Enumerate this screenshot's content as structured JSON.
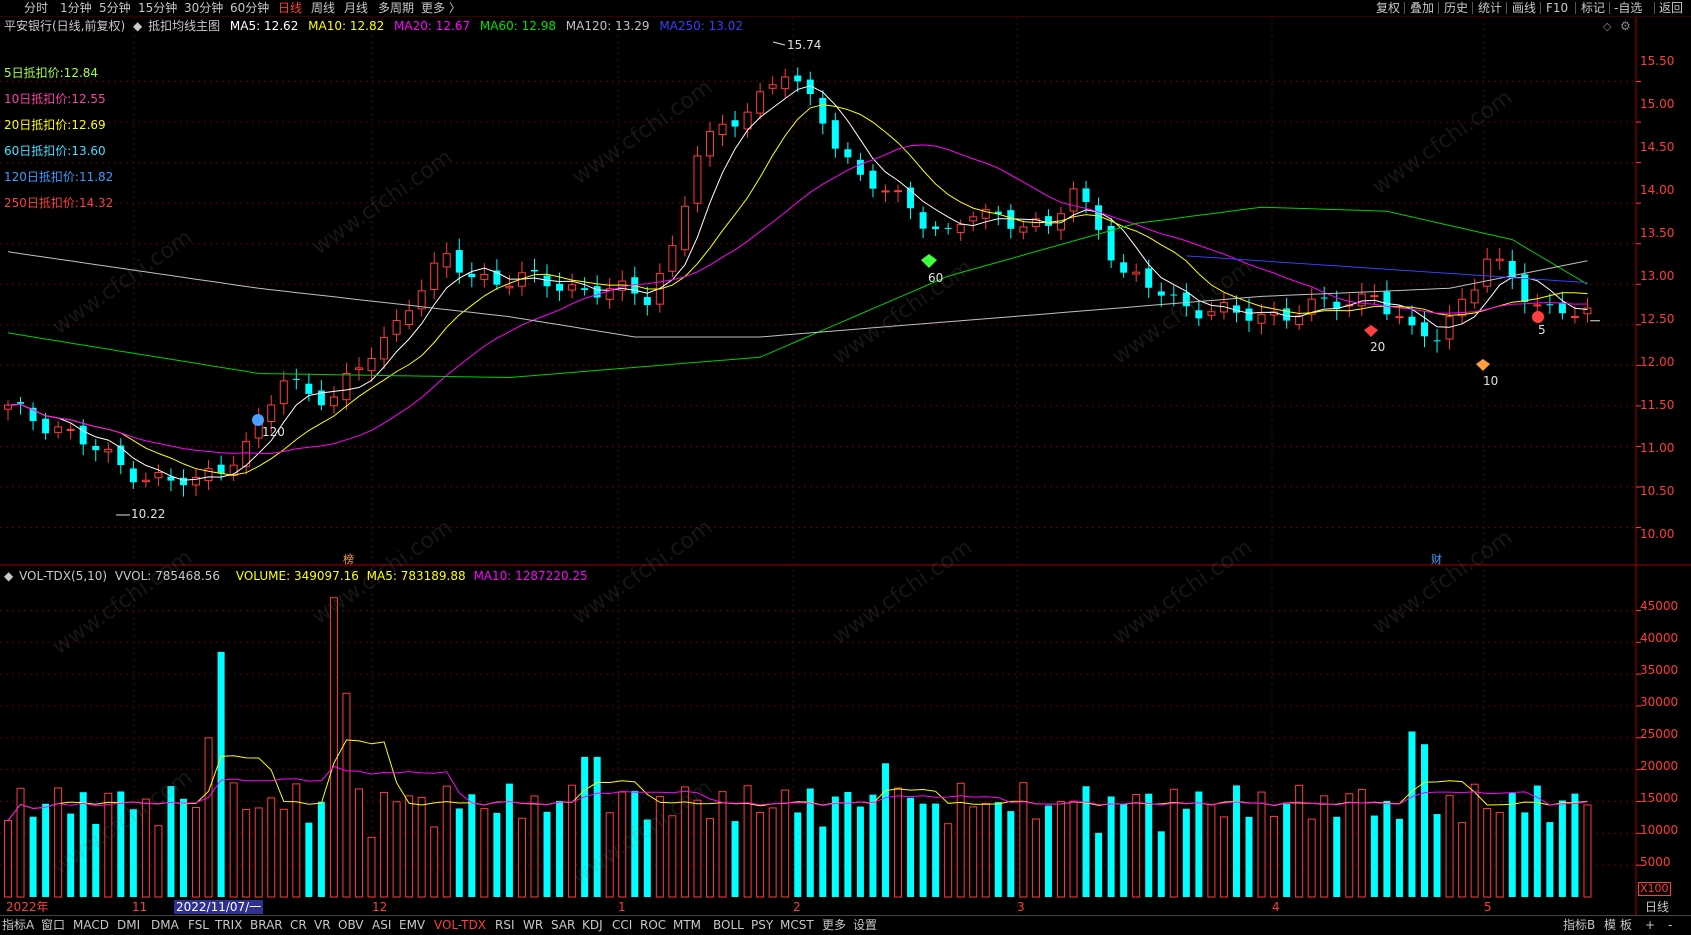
{
  "colors": {
    "up": "#ff3c3c",
    "down": "#00ffff",
    "ma5": "#ffffff",
    "ma10": "#ffff00",
    "ma20": "#ff00ff",
    "ma60": "#00d000",
    "ma120": "#c0c0c0",
    "ma250": "#3c3cff",
    "grid": "#5a0000",
    "axis_text": "#ff3c3c"
  },
  "top_periods": [
    "分时",
    "1分钟",
    "5分钟",
    "15分钟",
    "30分钟",
    "60分钟",
    "日线",
    "周线",
    "月线",
    "多周期",
    "更多 〉"
  ],
  "active_period": "日线",
  "top_right": [
    "复权",
    "叠加",
    "历史",
    "统计",
    "画线",
    "F10",
    "标记",
    "-自选",
    "返回"
  ],
  "main_info": {
    "stock": "平安银行(日线,前复权)",
    "indicator": "抵扣均线主图",
    "ma5": "MA5: 12.62",
    "ma10": "MA10: 12.82",
    "ma20": "MA20: 12.67",
    "ma60": "MA60: 12.98",
    "ma120": "MA120: 13.29",
    "ma250": "MA250: 13.02"
  },
  "deduct_prices": [
    {
      "label": "5日抵扣价:12.84",
      "color": "#a0ff40"
    },
    {
      "label": "10日抵扣价:12.55",
      "color": "#ff3caa"
    },
    {
      "label": "20日抵扣价:12.69",
      "color": "#ffff00"
    },
    {
      "label": "60日抵扣价:13.60",
      "color": "#40e0ff"
    },
    {
      "label": "120日抵扣价:11.82",
      "color": "#3c9cff"
    },
    {
      "label": "250日抵扣价:14.32",
      "color": "#ff3c3c"
    }
  ],
  "vol_info": {
    "name": "VOL-TDX(5,10)",
    "vvol": "VVOL: 785468.56",
    "volume": "VOLUME: 349097.16",
    "ma5": "MA5: 783189.88",
    "ma10": "MA10: 1287220.25"
  },
  "chart_data": {
    "type": "candlestick",
    "price_axis": {
      "ticks": [
        "15.50",
        "15.00",
        "14.50",
        "14.00",
        "13.50",
        "13.00",
        "12.50",
        "12.00",
        "11.50",
        "11.00",
        "10.50",
        "10.00"
      ],
      "range": [
        9.6,
        15.95
      ]
    },
    "volume_axis": {
      "ticks": [
        "45000",
        "40000",
        "35000",
        "30000",
        "25000",
        "20000",
        "15000",
        "10000",
        "5000"
      ],
      "range": [
        0,
        49000
      ],
      "unit": "X100"
    },
    "x_labels": [
      "2022年",
      "11",
      "12",
      "1",
      "2",
      "3",
      "4",
      "5"
    ],
    "cursor_date": "2022/11/07/一",
    "high_label": "15.74",
    "low_label": "10.22",
    "markers": [
      {
        "label": "120",
        "color": "#4aa0ff"
      },
      {
        "label": "60",
        "color": "#40ff40"
      },
      {
        "label": "20",
        "color": "#ff4040"
      },
      {
        "label": "10",
        "color": "#ffa040"
      },
      {
        "label": "5",
        "color": "#ff4040"
      }
    ],
    "event_tags": [
      "榜",
      "财"
    ],
    "period_tag": "日线"
  },
  "bottom_tabs": [
    "指标A",
    "窗口",
    "MACD",
    "DMI",
    "DMA",
    "FSL",
    "TRIX",
    "BRAR",
    "CR",
    "VR",
    "OBV",
    "ASI",
    "EMV",
    "VOL-TDX",
    "RSI",
    "WR",
    "SAR",
    "KDJ",
    "CCI",
    "ROC",
    "MTM",
    "BOLL",
    "PSY",
    "MCST",
    "更多",
    "设置"
  ],
  "active_tab": "VOL-TDX",
  "bottom_right": [
    "指标B",
    "模",
    "板",
    "+",
    "-"
  ]
}
